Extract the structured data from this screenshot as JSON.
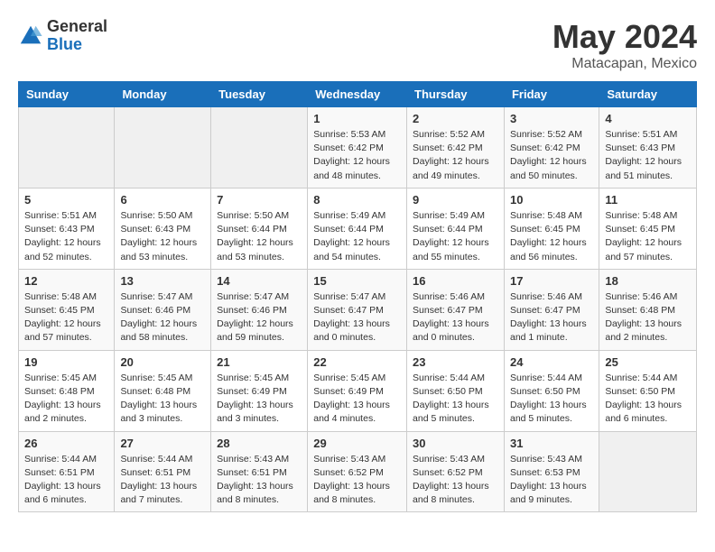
{
  "header": {
    "logo_general": "General",
    "logo_blue": "Blue",
    "month": "May 2024",
    "location": "Matacapan, Mexico"
  },
  "weekdays": [
    "Sunday",
    "Monday",
    "Tuesday",
    "Wednesday",
    "Thursday",
    "Friday",
    "Saturday"
  ],
  "weeks": [
    [
      {
        "day": "",
        "info": ""
      },
      {
        "day": "",
        "info": ""
      },
      {
        "day": "",
        "info": ""
      },
      {
        "day": "1",
        "info": "Sunrise: 5:53 AM\nSunset: 6:42 PM\nDaylight: 12 hours\nand 48 minutes."
      },
      {
        "day": "2",
        "info": "Sunrise: 5:52 AM\nSunset: 6:42 PM\nDaylight: 12 hours\nand 49 minutes."
      },
      {
        "day": "3",
        "info": "Sunrise: 5:52 AM\nSunset: 6:42 PM\nDaylight: 12 hours\nand 50 minutes."
      },
      {
        "day": "4",
        "info": "Sunrise: 5:51 AM\nSunset: 6:43 PM\nDaylight: 12 hours\nand 51 minutes."
      }
    ],
    [
      {
        "day": "5",
        "info": "Sunrise: 5:51 AM\nSunset: 6:43 PM\nDaylight: 12 hours\nand 52 minutes."
      },
      {
        "day": "6",
        "info": "Sunrise: 5:50 AM\nSunset: 6:43 PM\nDaylight: 12 hours\nand 53 minutes."
      },
      {
        "day": "7",
        "info": "Sunrise: 5:50 AM\nSunset: 6:44 PM\nDaylight: 12 hours\nand 53 minutes."
      },
      {
        "day": "8",
        "info": "Sunrise: 5:49 AM\nSunset: 6:44 PM\nDaylight: 12 hours\nand 54 minutes."
      },
      {
        "day": "9",
        "info": "Sunrise: 5:49 AM\nSunset: 6:44 PM\nDaylight: 12 hours\nand 55 minutes."
      },
      {
        "day": "10",
        "info": "Sunrise: 5:48 AM\nSunset: 6:45 PM\nDaylight: 12 hours\nand 56 minutes."
      },
      {
        "day": "11",
        "info": "Sunrise: 5:48 AM\nSunset: 6:45 PM\nDaylight: 12 hours\nand 57 minutes."
      }
    ],
    [
      {
        "day": "12",
        "info": "Sunrise: 5:48 AM\nSunset: 6:45 PM\nDaylight: 12 hours\nand 57 minutes."
      },
      {
        "day": "13",
        "info": "Sunrise: 5:47 AM\nSunset: 6:46 PM\nDaylight: 12 hours\nand 58 minutes."
      },
      {
        "day": "14",
        "info": "Sunrise: 5:47 AM\nSunset: 6:46 PM\nDaylight: 12 hours\nand 59 minutes."
      },
      {
        "day": "15",
        "info": "Sunrise: 5:47 AM\nSunset: 6:47 PM\nDaylight: 13 hours\nand 0 minutes."
      },
      {
        "day": "16",
        "info": "Sunrise: 5:46 AM\nSunset: 6:47 PM\nDaylight: 13 hours\nand 0 minutes."
      },
      {
        "day": "17",
        "info": "Sunrise: 5:46 AM\nSunset: 6:47 PM\nDaylight: 13 hours\nand 1 minute."
      },
      {
        "day": "18",
        "info": "Sunrise: 5:46 AM\nSunset: 6:48 PM\nDaylight: 13 hours\nand 2 minutes."
      }
    ],
    [
      {
        "day": "19",
        "info": "Sunrise: 5:45 AM\nSunset: 6:48 PM\nDaylight: 13 hours\nand 2 minutes."
      },
      {
        "day": "20",
        "info": "Sunrise: 5:45 AM\nSunset: 6:48 PM\nDaylight: 13 hours\nand 3 minutes."
      },
      {
        "day": "21",
        "info": "Sunrise: 5:45 AM\nSunset: 6:49 PM\nDaylight: 13 hours\nand 3 minutes."
      },
      {
        "day": "22",
        "info": "Sunrise: 5:45 AM\nSunset: 6:49 PM\nDaylight: 13 hours\nand 4 minutes."
      },
      {
        "day": "23",
        "info": "Sunrise: 5:44 AM\nSunset: 6:50 PM\nDaylight: 13 hours\nand 5 minutes."
      },
      {
        "day": "24",
        "info": "Sunrise: 5:44 AM\nSunset: 6:50 PM\nDaylight: 13 hours\nand 5 minutes."
      },
      {
        "day": "25",
        "info": "Sunrise: 5:44 AM\nSunset: 6:50 PM\nDaylight: 13 hours\nand 6 minutes."
      }
    ],
    [
      {
        "day": "26",
        "info": "Sunrise: 5:44 AM\nSunset: 6:51 PM\nDaylight: 13 hours\nand 6 minutes."
      },
      {
        "day": "27",
        "info": "Sunrise: 5:44 AM\nSunset: 6:51 PM\nDaylight: 13 hours\nand 7 minutes."
      },
      {
        "day": "28",
        "info": "Sunrise: 5:43 AM\nSunset: 6:51 PM\nDaylight: 13 hours\nand 8 minutes."
      },
      {
        "day": "29",
        "info": "Sunrise: 5:43 AM\nSunset: 6:52 PM\nDaylight: 13 hours\nand 8 minutes."
      },
      {
        "day": "30",
        "info": "Sunrise: 5:43 AM\nSunset: 6:52 PM\nDaylight: 13 hours\nand 8 minutes."
      },
      {
        "day": "31",
        "info": "Sunrise: 5:43 AM\nSunset: 6:53 PM\nDaylight: 13 hours\nand 9 minutes."
      },
      {
        "day": "",
        "info": ""
      }
    ]
  ]
}
